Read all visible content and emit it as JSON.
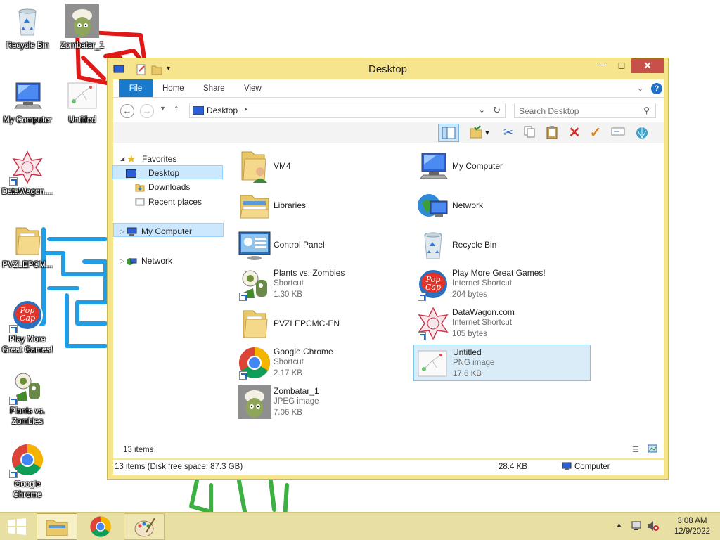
{
  "desktop": {
    "icons": [
      {
        "label": "Recycle Bin",
        "icon": "recycle-bin-icon"
      },
      {
        "label": "Zombatar_1",
        "icon": "zombie-image-icon"
      },
      {
        "label": "My Computer",
        "icon": "computer-icon"
      },
      {
        "label": "Untitled",
        "icon": "png-image-icon"
      },
      {
        "label": "DataWagon....",
        "icon": "datawagon-icon"
      },
      {
        "label": "PVZLEPCM...",
        "icon": "folder-icon"
      },
      {
        "label": "Play More Great Games!",
        "icon": "popcap-icon"
      },
      {
        "label": "Plants vs. Zombies",
        "icon": "plants-vs-zombies-icon"
      },
      {
        "label": "Google Chrome",
        "icon": "chrome-icon"
      }
    ]
  },
  "window": {
    "title": "Desktop",
    "tabs": [
      "File",
      "Home",
      "Share",
      "View"
    ],
    "address": "Desktop",
    "search_placeholder": "Search Desktop",
    "nav": {
      "favorites": "Favorites",
      "desktop": "Desktop",
      "downloads": "Downloads",
      "recent": "Recent places",
      "computer": "My Computer",
      "network": "Network"
    },
    "items": [
      {
        "name": "VM4",
        "line2": "",
        "line3": ""
      },
      {
        "name": "My Computer",
        "line2": "",
        "line3": ""
      },
      {
        "name": "Libraries",
        "line2": "",
        "line3": ""
      },
      {
        "name": "Network",
        "line2": "",
        "line3": ""
      },
      {
        "name": "Control Panel",
        "line2": "",
        "line3": ""
      },
      {
        "name": "Recycle Bin",
        "line2": "",
        "line3": ""
      },
      {
        "name": "Plants vs. Zombies",
        "line2": "Shortcut",
        "line3": "1.30 KB"
      },
      {
        "name": "Play More Great Games!",
        "line2": "Internet Shortcut",
        "line3": "204 bytes"
      },
      {
        "name": "PVZLEPCMC-EN",
        "line2": "",
        "line3": ""
      },
      {
        "name": "DataWagon.com",
        "line2": "Internet Shortcut",
        "line3": "105 bytes"
      },
      {
        "name": "Google Chrome",
        "line2": "Shortcut",
        "line3": "2.17 KB"
      },
      {
        "name": "Untitled",
        "line2": "PNG image",
        "line3": "17.6 KB"
      },
      {
        "name": "Zombatar_1",
        "line2": "JPEG image",
        "line3": "7.06 KB"
      }
    ],
    "item_count": "13 items",
    "status": {
      "left": "13 items (Disk free space: 87.3 GB)",
      "size": "28.4 KB",
      "location": "Computer"
    }
  },
  "taskbar": {
    "time": "3:08 AM",
    "date": "12/9/2022"
  }
}
